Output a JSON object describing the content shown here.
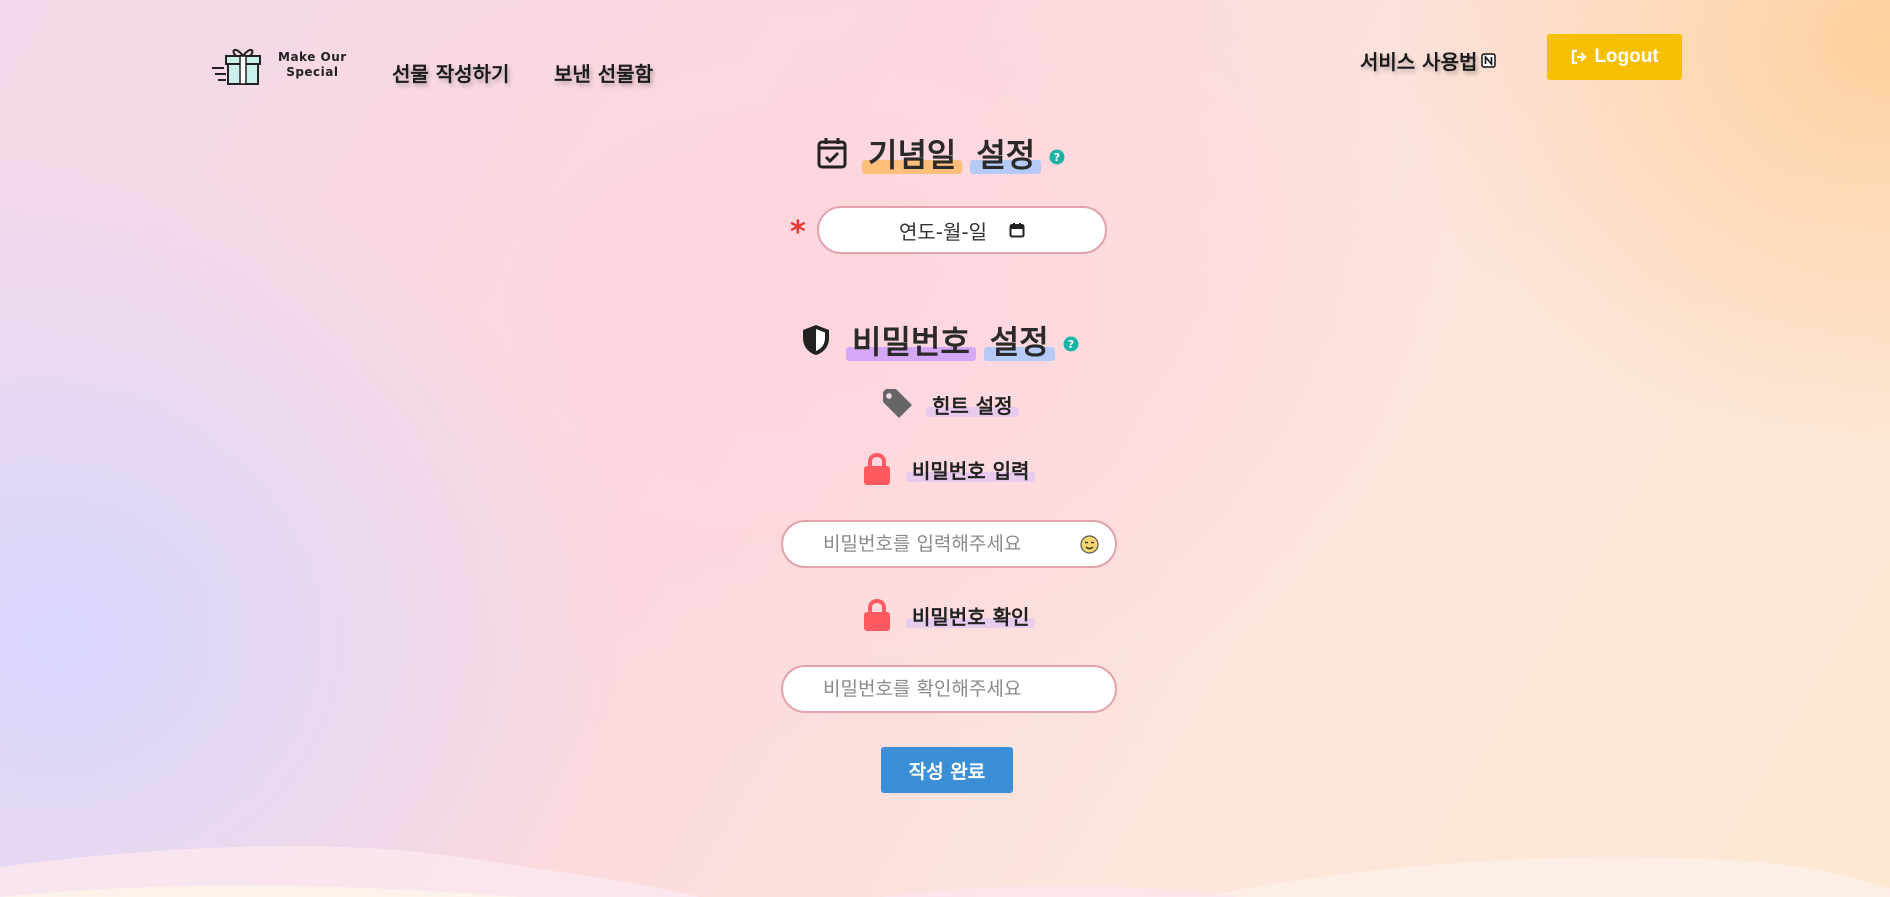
{
  "header": {
    "logo": {
      "line1": "Make Our",
      "line2": "Special"
    },
    "nav": {
      "write_gift": "선물 작성하기",
      "sent_box": "보낸 선물함",
      "guide": "서비스 사용법"
    },
    "logout_label": "Logout"
  },
  "anniversary": {
    "title_part1": "기념일",
    "title_part2": "설정",
    "required_mark": "*",
    "date_placeholder": "연도-월-일"
  },
  "password": {
    "title_part1": "비밀번호",
    "title_part2": "설정",
    "hint_label": "힌트 설정",
    "input_label": "비밀번호 입력",
    "input_placeholder": "비밀번호를 입력해주세요",
    "confirm_label": "비밀번호 확인",
    "confirm_placeholder": "비밀번호를 확인해주세요"
  },
  "submit_label": "작성 완료",
  "colors": {
    "logout_bg": "#f6c000",
    "submit_bg": "#3b8fd6",
    "help_icon": "#1ab3a6",
    "lock_icon": "#ff5a5f",
    "required": "#e53935"
  },
  "icons": [
    "gift-logo-icon",
    "notion-icon",
    "logout-icon",
    "calendar-check-icon",
    "help-icon",
    "calendar-icon",
    "shield-icon",
    "tag-icon",
    "lock-icon",
    "emoji-icon"
  ]
}
